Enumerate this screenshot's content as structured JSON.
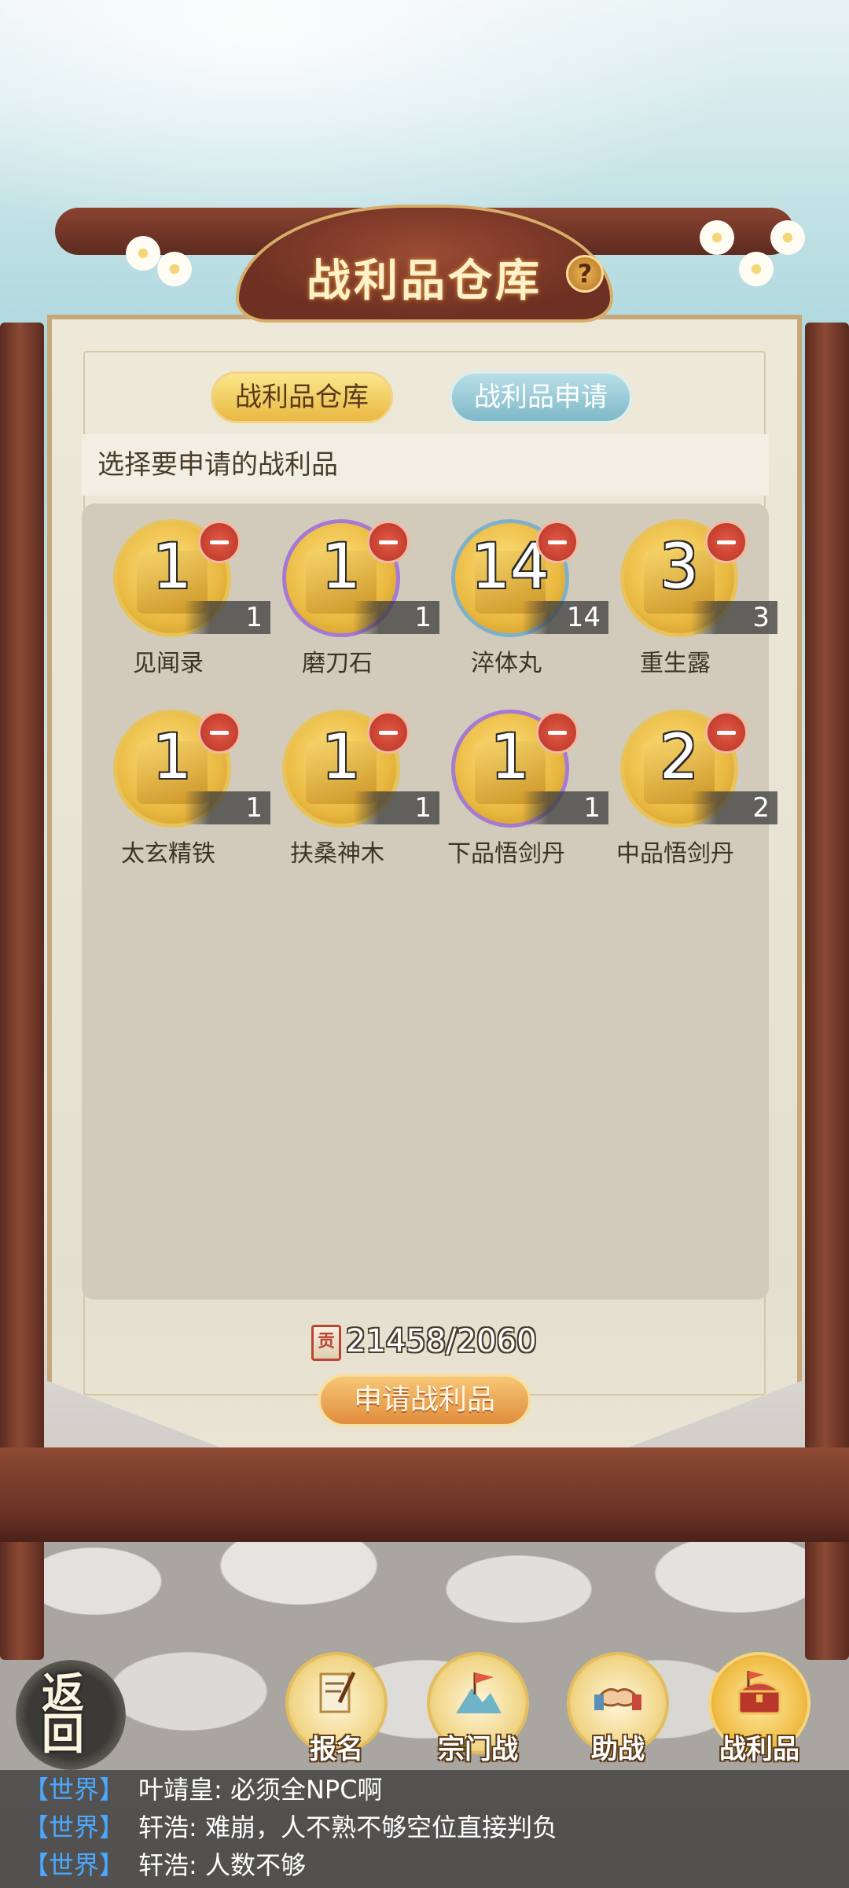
{
  "header": {
    "title": "战利品仓库",
    "help_icon": "?"
  },
  "tabs": [
    {
      "label": "战利品仓库",
      "active": true
    },
    {
      "label": "战利品申请",
      "active": false
    }
  ],
  "prompt": "选择要申请的战利品",
  "items": [
    {
      "name": "见闻录",
      "big": "1",
      "count": "1",
      "icon": "book-icon"
    },
    {
      "name": "磨刀石",
      "big": "1",
      "count": "1",
      "icon": "whetstone-icon"
    },
    {
      "name": "淬体丸",
      "big": "14",
      "count": "14",
      "icon": "pill-icon"
    },
    {
      "name": "重生露",
      "big": "3",
      "count": "3",
      "icon": "gourd-icon"
    },
    {
      "name": "太玄精铁",
      "big": "1",
      "count": "1",
      "icon": "iron-ore-icon"
    },
    {
      "name": "扶桑神木",
      "big": "1",
      "count": "1",
      "icon": "wood-icon"
    },
    {
      "name": "下品悟剑丹",
      "big": "1",
      "count": "1",
      "icon": "orb-icon"
    },
    {
      "name": "中品悟剑丹",
      "big": "2",
      "count": "2",
      "icon": "orb-icon"
    }
  ],
  "contribution": {
    "icon_char": "贡",
    "value": "21458/2060"
  },
  "apply_button": "申请战利品",
  "back_button": "返回",
  "nav": [
    {
      "label": "报名",
      "icon": "scroll-brush-icon"
    },
    {
      "label": "宗门战",
      "icon": "flag-mountain-icon"
    },
    {
      "label": "助战",
      "icon": "handshake-icon"
    },
    {
      "label": "战利品",
      "icon": "treasure-chest-icon"
    }
  ],
  "chat": [
    {
      "channel": "【世界】",
      "text": "叶靖皇: 必须全NPC啊"
    },
    {
      "channel": "【世界】",
      "text": "轩浩: 难崩，人不熟不够空位直接判负"
    },
    {
      "channel": "【世界】",
      "text": "轩浩: 人数不够"
    }
  ]
}
